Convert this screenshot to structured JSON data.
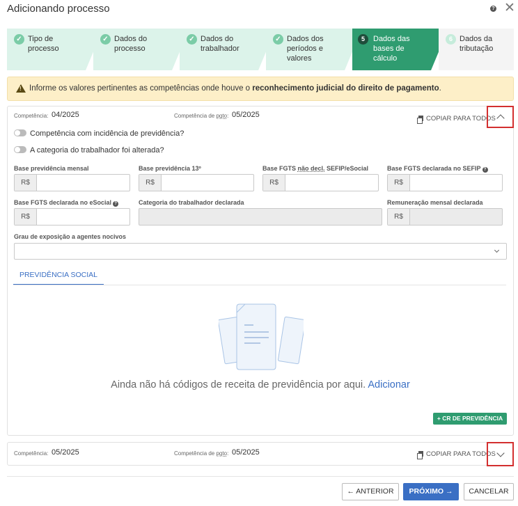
{
  "window": {
    "title": "Adicionando processo",
    "help_symbol": "?",
    "close_symbol": "✕"
  },
  "steps": [
    {
      "label": "Tipo de processo",
      "state": "done"
    },
    {
      "label": "Dados do processo",
      "state": "done"
    },
    {
      "label": "Dados do trabalhador",
      "state": "done"
    },
    {
      "label": "Dados dos períodos e valores",
      "state": "done"
    },
    {
      "label": "Dados das bases de cálculo",
      "state": "active",
      "number": "5"
    },
    {
      "label": "Dados da tributação",
      "state": "future",
      "number": "6"
    }
  ],
  "alert": {
    "text_before": "Informe os valores pertinentes as competências onde houve o ",
    "text_bold": "reconhecimento judicial do direito de pagamento",
    "text_after": "."
  },
  "card1": {
    "competencia_label": "Competência:",
    "competencia_value": "04/2025",
    "pgto_label_prefix": "Competência de ",
    "pgto_label_abbr": "pgto",
    "pgto_label_suffix": ":",
    "pgto_value": "05/2025",
    "copy_label": "COPIAR PARA TODOS",
    "toggle1": "Competência com incidência de previdência?",
    "toggle2": "A categoria do trabalhador foi alterada?",
    "fields": {
      "base_prev_mensal": "Base previdência mensal",
      "base_prev_13": "Base previdência 13º",
      "base_fgts_nao_decl_prefix": "Base FGTS ",
      "base_fgts_nao_decl_abbr": "não decl.",
      "base_fgts_nao_decl_suffix": " SEFIP/eSocial",
      "base_fgts_sefip": "Base FGTS declarada no SEFIP",
      "base_fgts_esocial": "Base FGTS declarada no eSocial",
      "categoria": "Categoria do trabalhador declarada",
      "remuneracao": "Remuneração mensal declarada",
      "grau": "Grau de exposição a agentes nocivos"
    },
    "currency_prefix": "R$",
    "tab_label": "PREVIDÊNCIA SOCIAL",
    "empty_text": "Ainda não há códigos de receita de previdência por aqui. ",
    "empty_link": "Adicionar",
    "cr_button": "CR DE PREVIDÊNCIA"
  },
  "card2": {
    "competencia_label": "Competência:",
    "competencia_value": "05/2025",
    "pgto_label_prefix": "Competência de ",
    "pgto_label_abbr": "pgto",
    "pgto_label_suffix": ":",
    "pgto_value": "05/2025",
    "copy_label": "COPIAR PARA TODOS"
  },
  "footer": {
    "prev": "ANTERIOR",
    "next": "PRÓXIMO",
    "cancel": "CANCELAR"
  },
  "colors": {
    "accent_green": "#2f9c70",
    "accent_blue": "#3a6fc4",
    "alert_bg": "#fdefc8",
    "highlight_red": "#d32f2f"
  }
}
